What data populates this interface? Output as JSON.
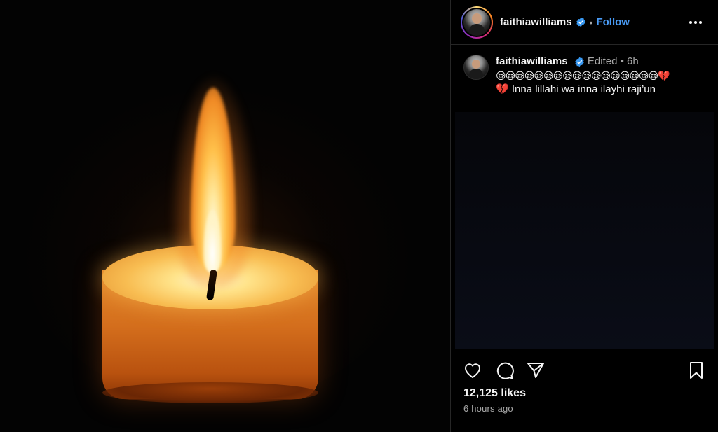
{
  "header": {
    "username": "faithiawilliams",
    "separator": "•",
    "follow_label": "Follow",
    "more_icon": "more-horizontal-icon"
  },
  "caption": {
    "username": "faithiawilliams",
    "edited_label": "Edited",
    "separator": "•",
    "age": "6h",
    "line1": "😪😪😪😪😪😪😪😪😪😪😪😪😪😪😪😪😪💔",
    "line2": "💔 Inna lillahi wa inna ilayhi raji’un"
  },
  "actions": {
    "like_icon": "heart-icon",
    "comment_icon": "comment-icon",
    "share_icon": "send-icon",
    "save_icon": "bookmark-icon"
  },
  "likes": "12,125 likes",
  "posted": "6 hours ago",
  "colors": {
    "background": "#000000",
    "text": "#f5f5f5",
    "muted": "#a8a8a8",
    "link": "#4a9cf7",
    "verified": "#3897f0",
    "divider": "#262626"
  }
}
